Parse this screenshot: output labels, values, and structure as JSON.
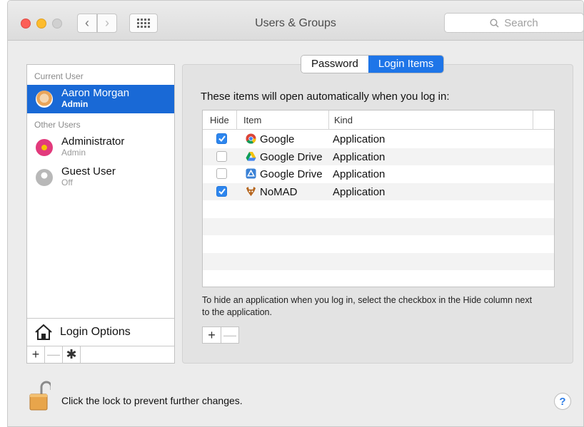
{
  "window": {
    "title": "Users & Groups"
  },
  "search": {
    "placeholder": "Search"
  },
  "sidebar": {
    "current_user_label": "Current User",
    "other_users_label": "Other Users",
    "users": [
      {
        "name": "Aaron Morgan",
        "role": "Admin",
        "selected": true
      },
      {
        "name": "Administrator",
        "role": "Admin"
      },
      {
        "name": "Guest User",
        "role": "Off"
      }
    ],
    "login_options_label": "Login Options",
    "add_label": "+",
    "remove_label": "—",
    "gear_label": "✱"
  },
  "tabs": [
    {
      "label": "Password",
      "active": false
    },
    {
      "label": "Login Items",
      "active": true
    }
  ],
  "login_items": {
    "heading": "These items will open automatically when you log in:",
    "columns": [
      "Hide",
      "Item",
      "Kind"
    ],
    "rows": [
      {
        "hide": true,
        "item": "Google",
        "kind": "Application",
        "icon": "chrome-icon"
      },
      {
        "hide": false,
        "item": "Google Drive",
        "kind": "Application",
        "icon": "google-drive-icon"
      },
      {
        "hide": false,
        "item": "Google Drive",
        "kind": "Application",
        "icon": "google-drive-blue-icon"
      },
      {
        "hide": true,
        "item": "NoMAD",
        "kind": "Application",
        "icon": "nomad-icon"
      }
    ],
    "note": "To hide an application when you log in, select the checkbox in the Hide column next to the application.",
    "add_label": "+",
    "remove_label": "—"
  },
  "footer": {
    "lock_text": "Click the lock to prevent further changes.",
    "help_label": "?"
  },
  "colors": {
    "accent": "#1e75e8",
    "selection": "#1969d6",
    "close": "#fc5f57",
    "minimize": "#fdbc2e"
  }
}
